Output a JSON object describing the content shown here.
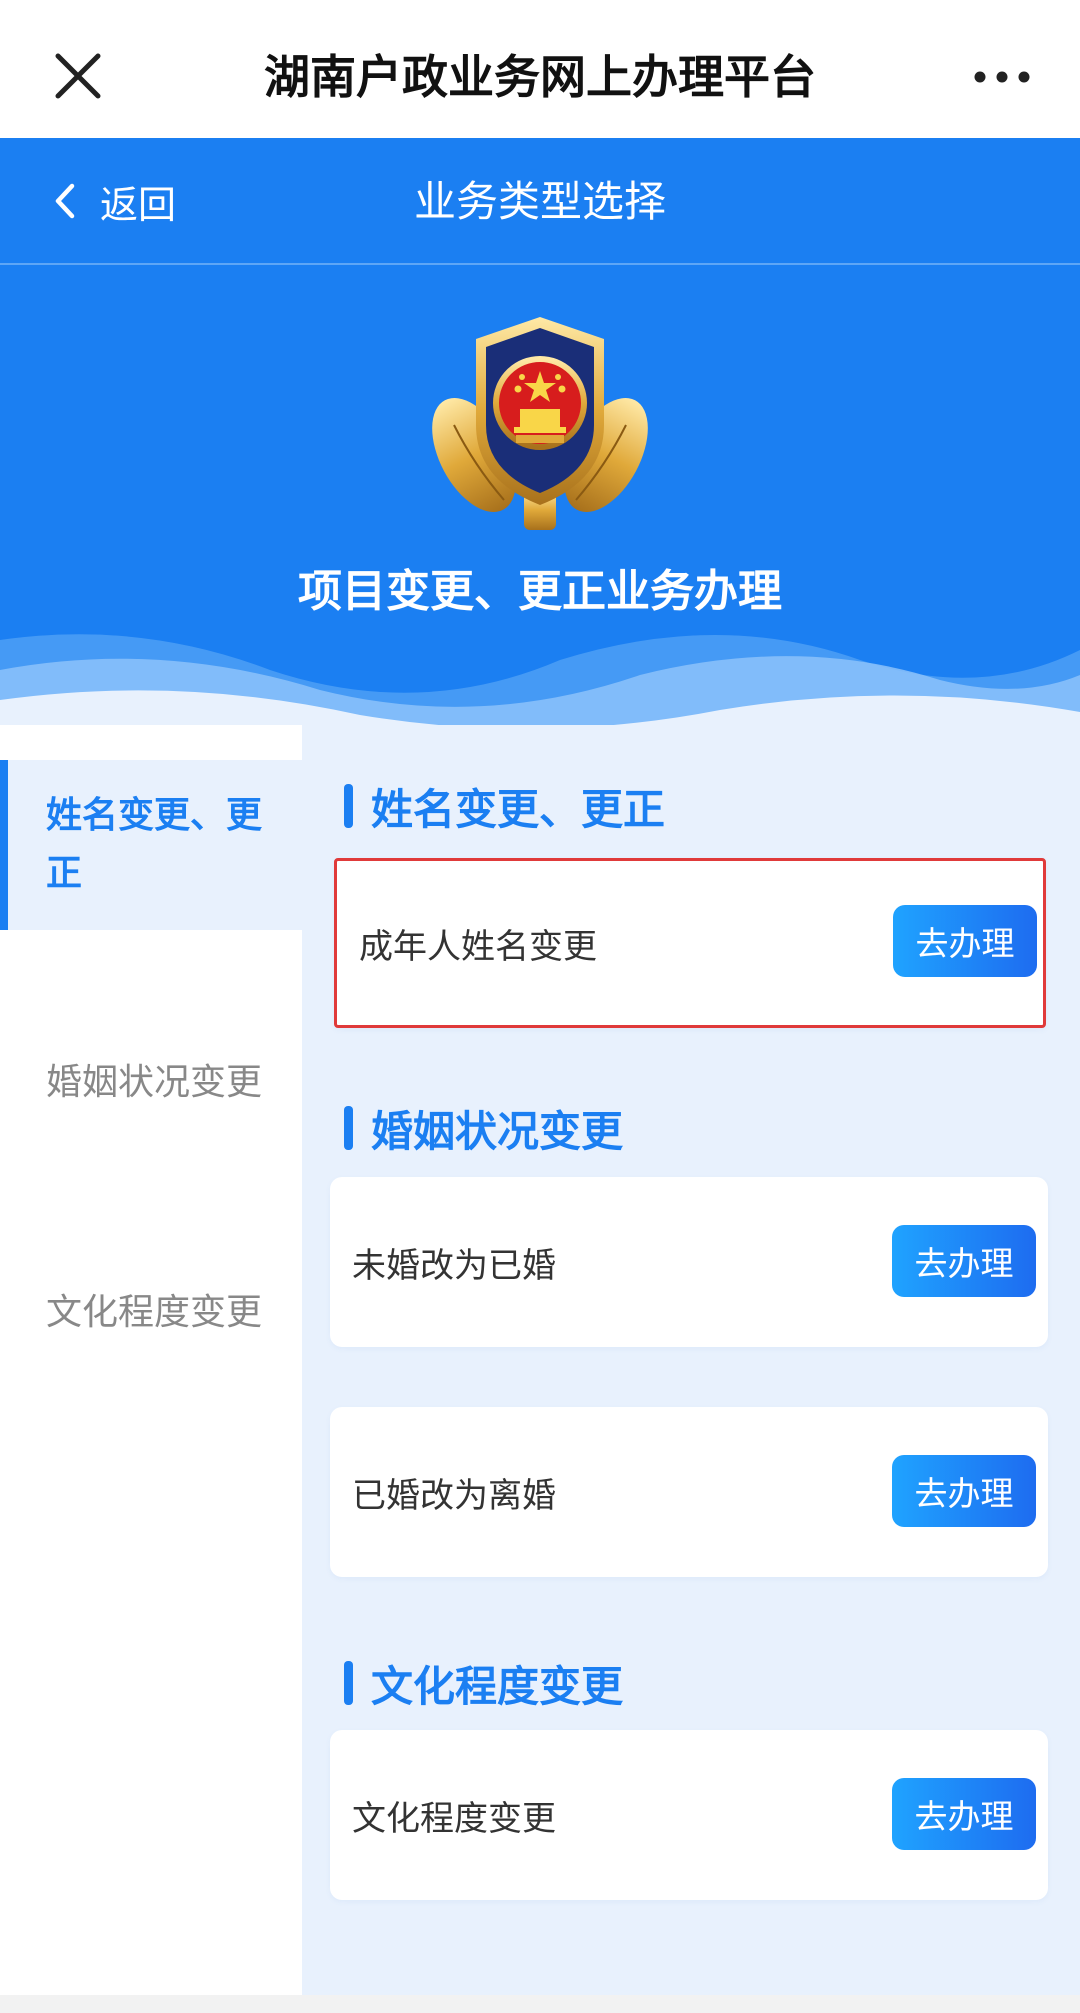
{
  "topbar": {
    "title": "湖南户政业务网上办理平台"
  },
  "navbar": {
    "back_label": "返回",
    "title": "业务类型选择"
  },
  "hero": {
    "title": "项目变更、更正业务办理"
  },
  "sidebar": {
    "items": [
      {
        "label": "姓名变更、更正",
        "active": true
      },
      {
        "label": "婚姻状况变更"
      },
      {
        "label": "文化程度变更"
      }
    ]
  },
  "sections": [
    {
      "title": "姓名变更、更正",
      "items": [
        {
          "label": "成年人姓名变更",
          "button": "去办理"
        }
      ]
    },
    {
      "title": "婚姻状况变更",
      "items": [
        {
          "label": "未婚改为已婚",
          "button": "去办理"
        },
        {
          "label": "已婚改为离婚",
          "button": "去办理"
        }
      ]
    },
    {
      "title": "文化程度变更",
      "items": [
        {
          "label": "文化程度变更",
          "button": "去办理"
        }
      ]
    }
  ],
  "colors": {
    "primary": "#1b7ff2",
    "highlight_border": "#e03a3a",
    "background": "#e8f1fd"
  }
}
